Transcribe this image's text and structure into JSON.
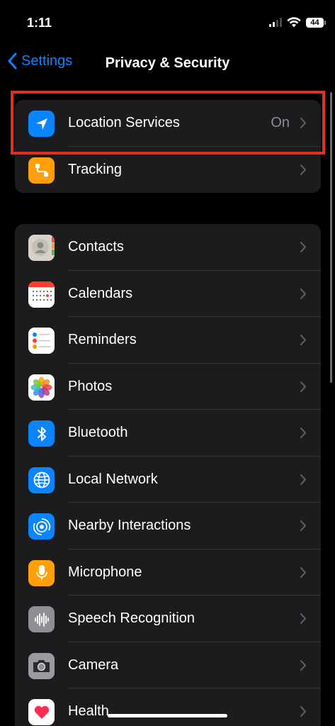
{
  "status_bar": {
    "time": "1:11",
    "battery": "44"
  },
  "nav": {
    "back_label": "Settings",
    "title": "Privacy & Security"
  },
  "group1": {
    "items": [
      {
        "label": "Location Services",
        "value": "On",
        "icon": "location-arrow-icon",
        "color": "#0a84ff"
      },
      {
        "label": "Tracking",
        "icon": "tracking-icon",
        "color": "#ff9f0a"
      }
    ]
  },
  "group2": {
    "items": [
      {
        "label": "Contacts",
        "icon": "contacts-icon"
      },
      {
        "label": "Calendars",
        "icon": "calendar-icon"
      },
      {
        "label": "Reminders",
        "icon": "reminders-icon"
      },
      {
        "label": "Photos",
        "icon": "photos-icon"
      },
      {
        "label": "Bluetooth",
        "icon": "bluetooth-icon",
        "color": "#0a84ff"
      },
      {
        "label": "Local Network",
        "icon": "globe-icon",
        "color": "#0a84ff"
      },
      {
        "label": "Nearby Interactions",
        "icon": "nearby-icon",
        "color": "#0a84ff"
      },
      {
        "label": "Microphone",
        "icon": "microphone-icon",
        "color": "#ff9f0a"
      },
      {
        "label": "Speech Recognition",
        "icon": "waveform-icon",
        "color": "#8e8e93"
      },
      {
        "label": "Camera",
        "icon": "camera-icon",
        "color": "#8e8e93"
      },
      {
        "label": "Health",
        "icon": "heart-icon",
        "color": "#ffffff"
      }
    ]
  },
  "colors": {
    "accent": "#0a84ff",
    "highlight": "#e0301e",
    "cell_bg": "#1c1c1e"
  }
}
